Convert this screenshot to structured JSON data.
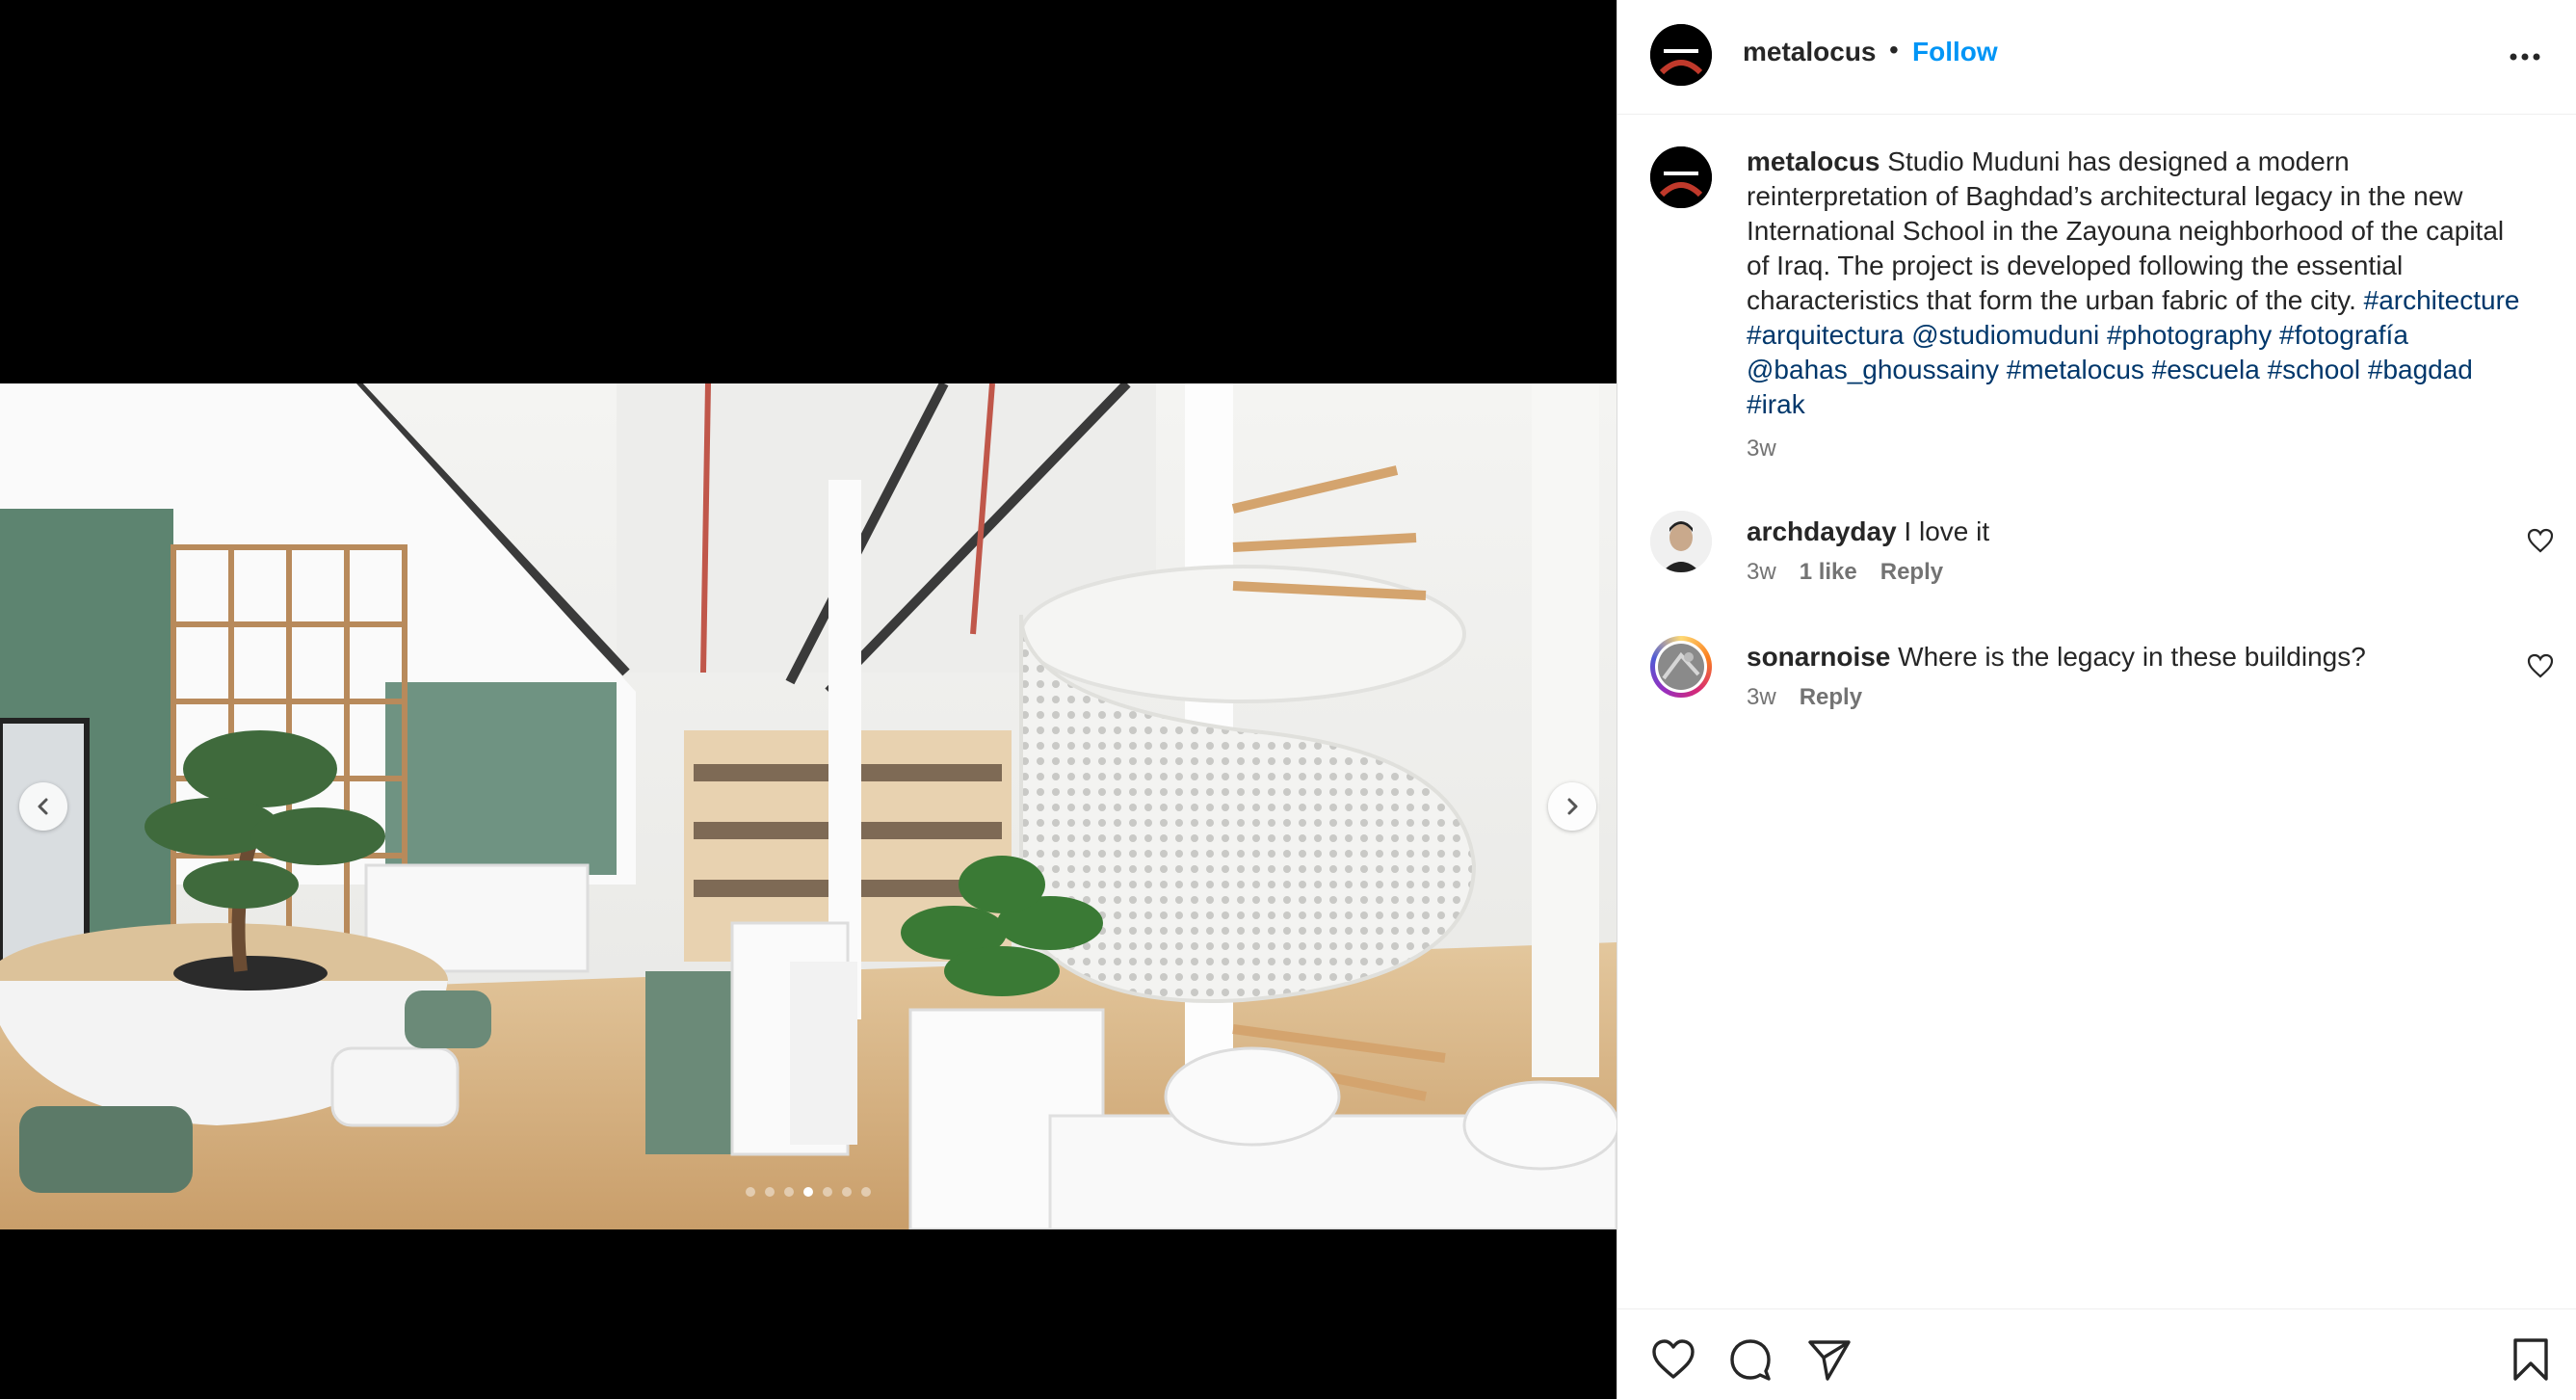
{
  "post": {
    "author": "metalocus",
    "separator": "•",
    "follow_label": "Follow"
  },
  "caption": {
    "author": "metalocus",
    "text": "Studio Muduni has designed a modern reinterpretation of Baghdad’s architectural legacy in the new International School in the Zayouna neighborhood of the capital of Iraq. The project is developed following the essential characteristics that form the urban fabric of the city.",
    "tags": [
      "#architecture",
      "#arquitectura",
      "@studiomuduni",
      "#photography",
      "#fotografía",
      "@bahas_ghoussainy",
      "#metalocus",
      "#escuela",
      "#school",
      "#bagdad",
      "#irak"
    ],
    "time": "3w"
  },
  "comments": [
    {
      "user": "archdayday",
      "text": "I love it",
      "time": "3w",
      "likes": "1 like",
      "reply_label": "Reply"
    },
    {
      "user": "sonarnoise",
      "text": "Where is the legacy in these buildings?",
      "time": "3w",
      "reply_label": "Reply"
    }
  ],
  "carousel": {
    "slide_count": 7,
    "active_index": 3
  },
  "icons": {
    "more": "more-options-icon",
    "prev": "chevron-left-icon",
    "next": "chevron-right-icon",
    "like": "heart-icon",
    "comment": "comment-bubble-icon",
    "share": "paper-plane-icon",
    "save": "bookmark-icon"
  },
  "colors": {
    "accent": "#0095f6",
    "hashtag": "#00376b",
    "muted": "#737373"
  }
}
